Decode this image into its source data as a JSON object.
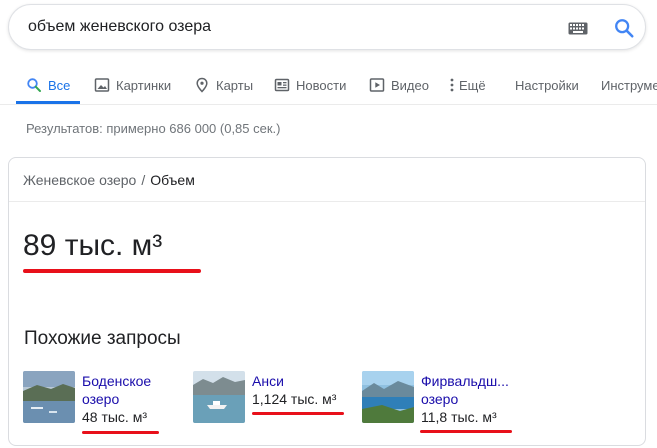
{
  "search": {
    "query": "объем женевского озера",
    "keyboard_icon": "keyboard-icon",
    "search_icon": "search-icon"
  },
  "tabs": [
    {
      "label": "Все",
      "icon": "search-icon",
      "active": true
    },
    {
      "label": "Картинки",
      "icon": "image-icon",
      "active": false
    },
    {
      "label": "Карты",
      "icon": "map-pin-icon",
      "active": false
    },
    {
      "label": "Новости",
      "icon": "news-icon",
      "active": false
    },
    {
      "label": "Видео",
      "icon": "play-icon",
      "active": false
    },
    {
      "label": "Ещё",
      "icon": "more-vertical-icon",
      "active": false
    },
    {
      "label": "Настройки",
      "icon": "",
      "active": false
    },
    {
      "label": "Инструменты",
      "icon": "",
      "active": false
    }
  ],
  "results_count": "Результатов: примерно 686 000 (0,85 сек.)",
  "card": {
    "breadcrumb_parent": "Женевское озеро",
    "breadcrumb_sep": "/",
    "breadcrumb_current": "Объем",
    "answer": "89 тыс. м³",
    "related_title": "Похожие запросы",
    "related": [
      {
        "name_line1": "Боденское",
        "name_line2": "озеро",
        "value": "48 тыс. м³"
      },
      {
        "name_line1": "Анси",
        "name_line2": "",
        "value": "1,124 тыс. м³"
      },
      {
        "name_line1": "Фирвальдш...",
        "name_line2": "озеро",
        "value": "11,8 тыс. м³"
      }
    ]
  },
  "colors": {
    "accent": "#1a73e8",
    "link": "#1a0dab",
    "highlight": "#e8101a"
  }
}
